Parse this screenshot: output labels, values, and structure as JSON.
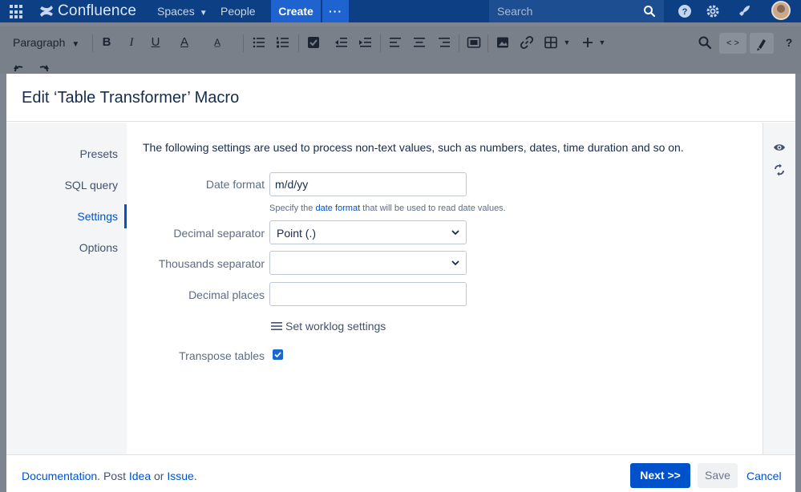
{
  "topnav": {
    "brand": "Confluence",
    "spaces": "Spaces",
    "people": "People",
    "create": "Create",
    "more": "···",
    "search_placeholder": "Search",
    "icons": [
      "app-switcher-icon",
      "confluence-logo-icon",
      "search-icon",
      "help-icon",
      "settings-icon",
      "notifications-icon",
      "avatar"
    ]
  },
  "toolbar": {
    "paragraph": "Paragraph",
    "bold": "B",
    "italic": "I",
    "underline": "U",
    "text_color": "A",
    "code_toggle": "< >"
  },
  "modal": {
    "title": "Edit ‘Table Transformer’ Macro",
    "nav": {
      "presets": "Presets",
      "sql_query": "SQL query",
      "settings": "Settings",
      "options": "Options",
      "active": "Settings"
    },
    "intro": "The following settings are used to process non-text values, such as numbers, dates, time duration and so on.",
    "fields": {
      "date_format_label": "Date format",
      "date_format_value": "m/d/yy",
      "help_prefix": "Specify the ",
      "help_link": "date format",
      "help_suffix": " that will be used to read date values.",
      "decimal_separator_label": "Decimal separator",
      "decimal_separator_value": "Point (.)",
      "thousands_separator_label": "Thousands separator",
      "thousands_separator_value": "",
      "decimal_places_label": "Decimal places",
      "decimal_places_value": "",
      "worklog_label": "Set worklog settings",
      "transpose_label": "Transpose tables",
      "transpose_checked": true
    },
    "footer": {
      "documentation": "Documentation",
      "dot": ". ",
      "post": "Post ",
      "idea": "Idea",
      "or": " or ",
      "issue": "Issue",
      "end": ".",
      "next": "Next >>",
      "save": "Save",
      "cancel": "Cancel"
    }
  },
  "colors": {
    "nav_bg": "#0c3f83",
    "primary": "#0052cc",
    "overlay": "#7f8590"
  }
}
